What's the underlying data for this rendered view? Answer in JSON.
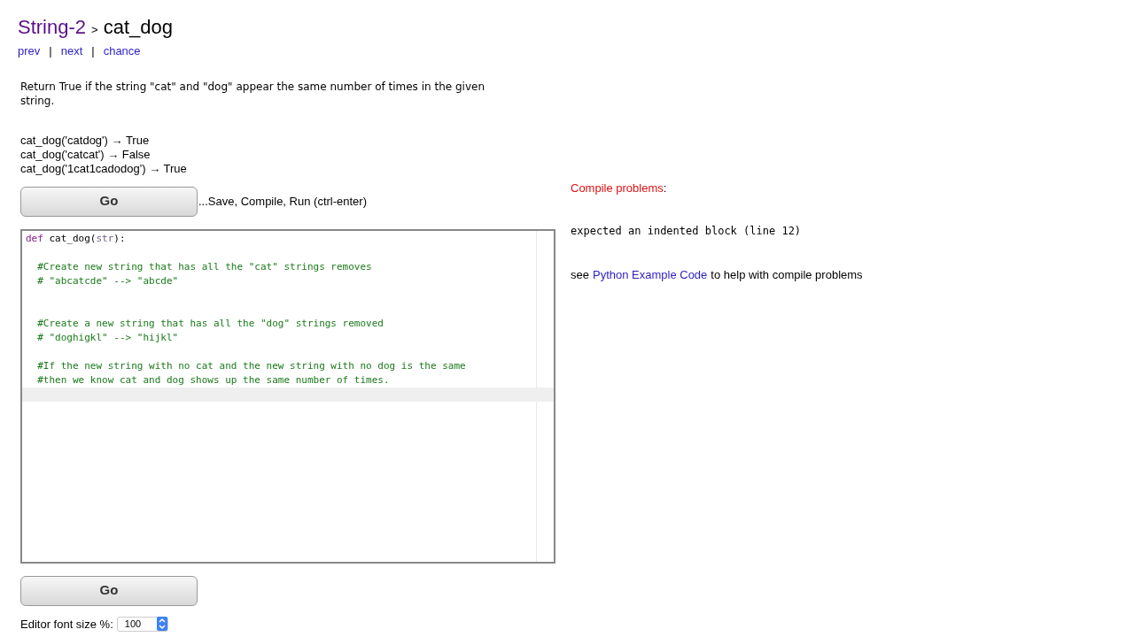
{
  "breadcrumb": {
    "section": "String-2",
    "separator": ">",
    "problem": "cat_dog"
  },
  "nav_links": [
    {
      "label": "prev"
    },
    {
      "label": "next"
    },
    {
      "label": "chance"
    }
  ],
  "nav_separator": "|",
  "description": "Return True if the string \"cat\" and \"dog\" appear the same number of times in the given string.",
  "examples": [
    "cat_dog('catdog') → True",
    "cat_dog('catcat') → False",
    "cat_dog('1cat1cadodog') → True"
  ],
  "go_button": "Go",
  "go_hint": "...Save, Compile, Run (ctrl-enter)",
  "editor": {
    "lines": [
      {
        "kind": "code",
        "tokens": [
          {
            "text": "def",
            "kind": "keyword"
          },
          {
            "text": " cat_dog(",
            "kind": "plain"
          },
          {
            "text": "str",
            "kind": "builtin"
          },
          {
            "text": "):",
            "kind": "plain"
          }
        ]
      },
      {
        "kind": "blank"
      },
      {
        "kind": "code",
        "tokens": [
          {
            "text": "  #Create new string that has all the \"cat\" strings removes",
            "kind": "comment"
          }
        ]
      },
      {
        "kind": "code",
        "tokens": [
          {
            "text": "  # \"abcatcde\" --> \"abcde\"",
            "kind": "comment"
          }
        ]
      },
      {
        "kind": "blank"
      },
      {
        "kind": "blank"
      },
      {
        "kind": "code",
        "tokens": [
          {
            "text": "  #Create a new string that has all the \"dog\" strings removed",
            "kind": "comment"
          }
        ]
      },
      {
        "kind": "code",
        "tokens": [
          {
            "text": "  # \"doghigkl\" --> \"hijkl\"",
            "kind": "comment"
          }
        ]
      },
      {
        "kind": "blank"
      },
      {
        "kind": "code",
        "tokens": [
          {
            "text": "  #If the new string with no cat and the new string with no dog is the same",
            "kind": "comment"
          }
        ]
      },
      {
        "kind": "code",
        "tokens": [
          {
            "text": "  #then we know cat and dog shows up the same number of times.",
            "kind": "comment"
          }
        ]
      },
      {
        "kind": "cursor_line"
      }
    ]
  },
  "go_button_bottom": "Go",
  "font_size": {
    "label": "Editor font size %:",
    "value": "100"
  },
  "compile": {
    "title": "Compile problems",
    "colon": ":",
    "error": "expected an indented block (line 12)",
    "help_before": "see",
    "help_link": "Python Example Code",
    "help_after": "to help with compile problems"
  }
}
